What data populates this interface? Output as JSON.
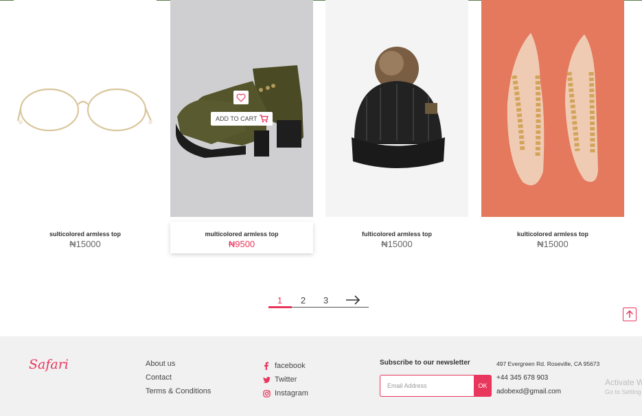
{
  "products": [
    {
      "name": "sulticolored armless top",
      "price": "₦15000"
    },
    {
      "name": "multicolored armless top",
      "price": "₦9500"
    },
    {
      "name": "fulticolored armless top",
      "price": "₦15000"
    },
    {
      "name": "kulticolored armless top",
      "price": "₦15000"
    }
  ],
  "hover_card": {
    "add_to_cart_label": "ADD TO CART"
  },
  "pagination": {
    "pages": [
      "1",
      "2",
      "3"
    ],
    "active": "1"
  },
  "footer": {
    "logo": "Safari",
    "links": [
      "About us",
      "Contact",
      "Terms & Conditions"
    ],
    "social": [
      {
        "label": "facebook",
        "icon": "facebook-icon"
      },
      {
        "label": "Twitter",
        "icon": "twitter-icon"
      },
      {
        "label": "Instagram",
        "icon": "instagram-icon"
      }
    ],
    "newsletter": {
      "title": "Subscribe to our newsletter",
      "placeholder": "Email Address",
      "button": "OK"
    },
    "contact": {
      "address": "497 Evergreen Rd. Roseville, CA 95673",
      "phone": "+44 345 678 903",
      "email": "adobexd@gmail.com"
    }
  },
  "watermark": {
    "line1": "Activate W",
    "line2": "Go to Setting"
  },
  "colors": {
    "accent": "#e8365d",
    "footer_bg": "#f1f1f1",
    "card4_bg": "#e4795e"
  }
}
